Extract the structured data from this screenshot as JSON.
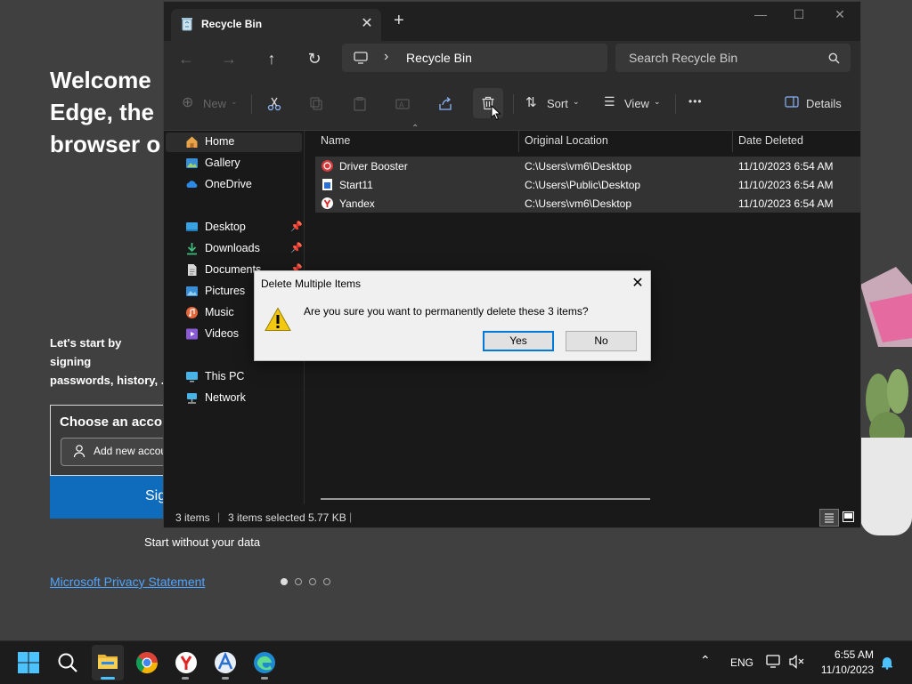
{
  "background_app": {
    "heading": "Welcome\nEdge, the\nbrowser o",
    "description": "Let's start by signing\npasswords, history, .",
    "choose_account": "Choose an acco",
    "add_account": "Add new accou",
    "sign_in": "Sig",
    "start_without": "Start without your data",
    "privacy": "Microsoft Privacy Statement"
  },
  "explorer": {
    "tab_title": "Recycle Bin",
    "tab_close": "✕",
    "new_tab": "+",
    "window_controls": {
      "minimize": "—",
      "maximize": "☐",
      "close": "✕"
    },
    "address": "Recycle Bin",
    "address_separator": "›",
    "search_placeholder": "Search Recycle Bin",
    "toolbar": {
      "new_label": "New",
      "sort_label": "Sort",
      "view_label": "View",
      "more_label": "•••",
      "details_label": "Details"
    },
    "nav": {
      "home": "Home",
      "gallery": "Gallery",
      "onedrive": "OneDrive",
      "desktop": "Desktop",
      "downloads": "Downloads",
      "documents": "Documents",
      "pictures": "Pictures",
      "music": "Music",
      "videos": "Videos",
      "this_pc": "This PC",
      "network": "Network"
    },
    "columns": {
      "name": "Name",
      "original_location": "Original Location",
      "date_deleted": "Date Deleted"
    },
    "files": [
      {
        "name": "Driver Booster",
        "location": "C:\\Users\\vm6\\Desktop",
        "date": "11/10/2023 6:54 AM"
      },
      {
        "name": "Start11",
        "location": "C:\\Users\\Public\\Desktop",
        "date": "11/10/2023 6:54 AM"
      },
      {
        "name": "Yandex",
        "location": "C:\\Users\\vm6\\Desktop",
        "date": "11/10/2023 6:54 AM"
      }
    ],
    "status": {
      "count": "3 items",
      "selected": "3 items selected",
      "size": "5.77 KB"
    }
  },
  "dialog": {
    "title": "Delete Multiple Items",
    "close": "✕",
    "message": "Are you sure you want to permanently delete these 3 items?",
    "yes": "Yes",
    "no": "No"
  },
  "taskbar": {
    "language": "ENG",
    "time": "6:55 AM",
    "date": "11/10/2023"
  },
  "colors": {
    "accent": "#0078d7",
    "edge_blue": "#0f6cbd",
    "warning_yellow": "#f2c811"
  }
}
